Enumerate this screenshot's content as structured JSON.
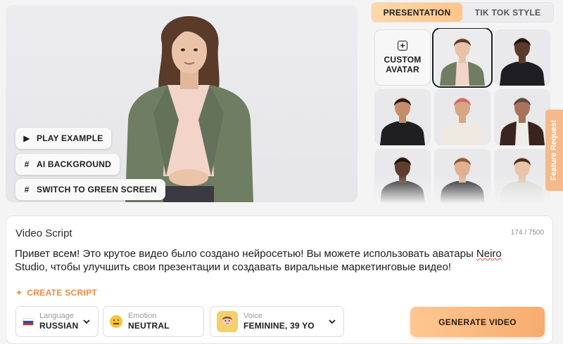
{
  "preview": {
    "play_label": "PLAY EXAMPLE",
    "ai_background_label": "AI BACKGROUND",
    "green_screen_label": "SWITCH TO GREEN SCREEN"
  },
  "tabs": [
    {
      "label": "PRESENTATION",
      "active": true
    },
    {
      "label": "TIK TOK STYLE",
      "active": false
    }
  ],
  "avatars": {
    "custom_label_line1": "CUSTOM",
    "custom_label_line2": "AVATAR",
    "selected_index": 0,
    "items": [
      {
        "skin": "#e8c2a8",
        "hair": "#5a3a28",
        "top": "#6f7e62",
        "shirt": "#f3d4c8",
        "bg": "#ececee"
      },
      {
        "skin": "#5a3a2a",
        "hair": "#1e1410",
        "top": "#1e1e22",
        "shirt": "#1e1e22",
        "bg": "#e9e9eb"
      },
      {
        "skin": "#c58d6a",
        "hair": "#2a1a12",
        "top": "#1f1f22",
        "shirt": "#1f1f22",
        "bg": "#e9e9eb"
      },
      {
        "skin": "#d8a684",
        "hair": "#d06a62",
        "top": "#eeeae2",
        "shirt": "#eeeae2",
        "bg": "#e9e9eb"
      },
      {
        "skin": "#a8735a",
        "hair": "#5a4a40",
        "top": "#3a2420",
        "shirt": "#eeeee8",
        "bg": "#e9e9eb"
      },
      {
        "skin": "#5e3e2e",
        "hair": "#1e1410",
        "top": "#2a2a2e",
        "shirt": "#2a2a2e",
        "bg": "#e9e9eb"
      },
      {
        "skin": "#e0b090",
        "hair": "#8a5a3a",
        "top": "#1f1f22",
        "shirt": "#1f1f22",
        "bg": "#e9e9eb"
      },
      {
        "skin": "#eac4a8",
        "hair": "#4a2e22",
        "top": "#d8d8d4",
        "shirt": "#d8d8d4",
        "bg": "#e9e9eb"
      }
    ]
  },
  "feature_request_label": "Feature Request",
  "script": {
    "title": "Video Script",
    "counter": "174 / 7500",
    "text_part1": "Привет всем! Это крутое видео было создано нейросетью! Вы можете использовать аватары ",
    "text_misspelled": "Neiro",
    "text_part2": " Studio, чтобы улучшить свои презентации и создавать виральные маркетинговые видео!",
    "create_label": "CREATE SCRIPT"
  },
  "language": {
    "caption": "Language",
    "value": "RUSSIAN",
    "flag_colors": [
      "#ffffff",
      "#1f4fb0",
      "#d5262c"
    ]
  },
  "emotion": {
    "caption": "Emotion",
    "value": "NEUTRAL"
  },
  "voice": {
    "caption": "Voice",
    "value": "FEMININE, 39 YO"
  },
  "generate_label": "GENERATE VIDEO",
  "colors": {
    "accent": "#f28a3e",
    "tab_active": "#ffc58a",
    "button": "#f7ac6e"
  }
}
